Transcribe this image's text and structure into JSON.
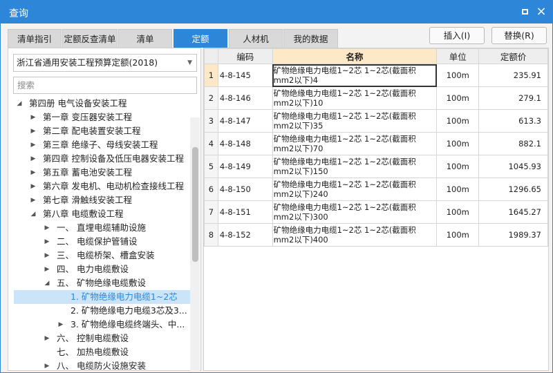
{
  "window": {
    "title": "查询",
    "maximize_icon": "maximize-icon",
    "close_label": "×"
  },
  "tabs": [
    {
      "label": "清单指引",
      "active": false
    },
    {
      "label": "定额反查清单",
      "active": false
    },
    {
      "label": "清单",
      "active": false
    },
    {
      "label": "定额",
      "active": true
    },
    {
      "label": "人材机",
      "active": false
    },
    {
      "label": "我的数据",
      "active": false
    }
  ],
  "actions": {
    "insert_label": "插入(I)",
    "replace_label": "替换(R)"
  },
  "left": {
    "dropdown_value": "浙江省通用安装工程预算定额(2018)",
    "search_placeholder": "搜索",
    "tree": [
      {
        "label": "第四册 电气设备安装工程",
        "state": "expanded"
      },
      {
        "label": "第一章 变压器安装工程",
        "state": "collapsed"
      },
      {
        "label": "第二章 配电装置安装工程",
        "state": "collapsed"
      },
      {
        "label": "第三章 绝缘子、母线安装工程",
        "state": "collapsed"
      },
      {
        "label": "第四章 控制设备及低压电器安装工程",
        "state": "collapsed"
      },
      {
        "label": "第五章 蓄电池安装工程",
        "state": "collapsed"
      },
      {
        "label": "第六章 发电机、电动机检查接线工程",
        "state": "collapsed"
      },
      {
        "label": "第七章 滑触线安装工程",
        "state": "collapsed"
      },
      {
        "label": "第八章 电缆敷设工程",
        "state": "expanded"
      },
      {
        "label": "一、 直埋电缆辅助设施",
        "state": "collapsed"
      },
      {
        "label": "二、 电缆保护管铺设",
        "state": "collapsed"
      },
      {
        "label": "三、 电缆桥架、槽盒安装",
        "state": "collapsed"
      },
      {
        "label": "四、 电力电缆敷设",
        "state": "collapsed"
      },
      {
        "label": "五、 矿物绝缘电缆敷设",
        "state": "expanded"
      },
      {
        "label": "1. 矿物绝缘电力电缆1~2芯",
        "state": "leaf"
      },
      {
        "label": "2. 矿物绝缘电力电缆3芯及3...",
        "state": "leaf"
      },
      {
        "label": "3. 矿物绝缘电缆终端头、中...",
        "state": "collapsed"
      },
      {
        "label": "六、 控制电缆敷设",
        "state": "collapsed"
      },
      {
        "label": "七、 加热电缆敷设",
        "state": "collapsed"
      },
      {
        "label": "八、 电缆防火设施安装",
        "state": "collapsed"
      }
    ]
  },
  "grid": {
    "headers": {
      "code": "编码",
      "name": "名称",
      "unit": "单位",
      "price": "定额价"
    },
    "rows": [
      {
        "num": "1",
        "code": "4-8-145",
        "name": "矿物绝缘电力电缆1~2芯 1~2芯(截面积mm2以下)4",
        "unit": "100m",
        "price": "235.91"
      },
      {
        "num": "2",
        "code": "4-8-146",
        "name": "矿物绝缘电力电缆1~2芯 1~2芯(截面积mm2以下)10",
        "unit": "100m",
        "price": "279.1"
      },
      {
        "num": "3",
        "code": "4-8-147",
        "name": "矿物绝缘电力电缆1~2芯 1~2芯(截面积mm2以下)35",
        "unit": "100m",
        "price": "613.3"
      },
      {
        "num": "4",
        "code": "4-8-148",
        "name": "矿物绝缘电力电缆1~2芯 1~2芯(截面积mm2以下)70",
        "unit": "100m",
        "price": "882.1"
      },
      {
        "num": "5",
        "code": "4-8-149",
        "name": "矿物绝缘电力电缆1~2芯 1~2芯(截面积mm2以下)150",
        "unit": "100m",
        "price": "1045.93"
      },
      {
        "num": "6",
        "code": "4-8-150",
        "name": "矿物绝缘电力电缆1~2芯 1~2芯(截面积mm2以下)240",
        "unit": "100m",
        "price": "1296.65"
      },
      {
        "num": "7",
        "code": "4-8-151",
        "name": "矿物绝缘电力电缆1~2芯 1~2芯(截面积mm2以下)300",
        "unit": "100m",
        "price": "1645.27"
      },
      {
        "num": "8",
        "code": "4-8-152",
        "name": "矿物绝缘电力电缆1~2芯 1~2芯(截面积mm2以下)400",
        "unit": "100m",
        "price": "1989.37"
      }
    ]
  },
  "colors": {
    "accent": "#2e86d9",
    "header_highlight": "#fde9c8",
    "selection": "#cce4f7"
  },
  "icons": {
    "expanded": "triangle-down-icon",
    "collapsed": "triangle-right-icon",
    "dropdown": "chevron-down-icon"
  }
}
